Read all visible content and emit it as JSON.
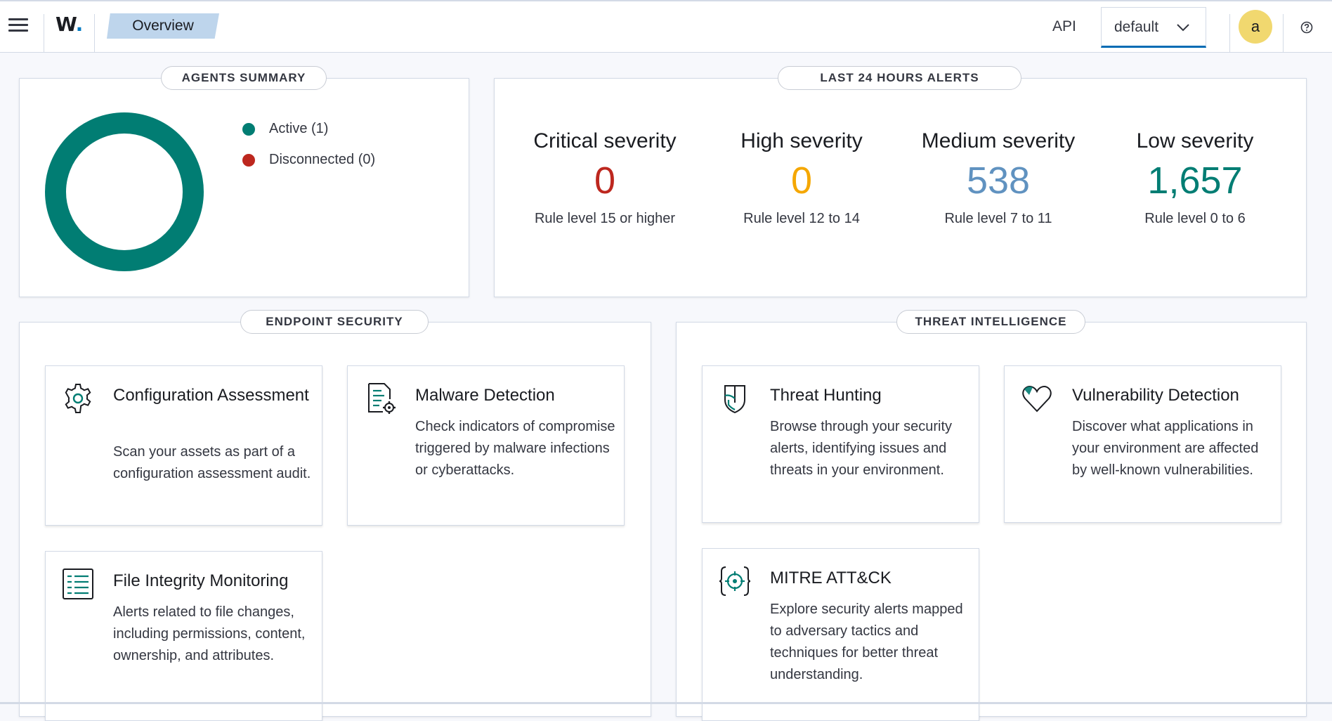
{
  "header": {
    "logo_text": "W",
    "logo_dot": ".",
    "breadcrumb": "Overview",
    "api_label": "API",
    "tenant": "default",
    "avatar_initial": "a"
  },
  "agents_summary": {
    "title": "AGENTS SUMMARY",
    "legend": [
      {
        "label": "Active (1)",
        "color": "#017d73",
        "count": 1
      },
      {
        "label": "Disconnected (0)",
        "color": "#bd271e",
        "count": 0
      }
    ]
  },
  "alerts": {
    "title": "LAST 24 HOURS ALERTS",
    "items": [
      {
        "title": "Critical severity",
        "value": "0",
        "rule": "Rule level 15 or higher",
        "color": "#bd271e"
      },
      {
        "title": "High severity",
        "value": "0",
        "rule": "Rule level 12 to 14",
        "color": "#f5a700"
      },
      {
        "title": "Medium severity",
        "value": "538",
        "rule": "Rule level 7 to 11",
        "color": "#6092c0"
      },
      {
        "title": "Low severity",
        "value": "1,657",
        "rule": "Rule level 0 to 6",
        "color": "#017d73"
      }
    ]
  },
  "endpoint_security": {
    "title": "ENDPOINT SECURITY",
    "cards": [
      {
        "icon": "gear-icon",
        "title": "Configuration Assessment",
        "desc": "Scan your assets as part of a configuration assessment audit."
      },
      {
        "icon": "document-gear-icon",
        "title": "Malware Detection",
        "desc": "Check indicators of compromise triggered by malware infections or cyberattacks."
      },
      {
        "icon": "list-table-icon",
        "title": "File Integrity Monitoring",
        "desc": "Alerts related to file changes, including permissions, content, ownership, and attributes."
      }
    ]
  },
  "threat_intelligence": {
    "title": "THREAT INTELLIGENCE",
    "cards": [
      {
        "icon": "shield-icon",
        "title": "Threat Hunting",
        "desc": "Browse through your security alerts, identifying issues and threats in your environment."
      },
      {
        "icon": "heart-icon",
        "title": "Vulnerability Detection",
        "desc": "Discover what applications in your environment are affected by well-known vulnerabilities."
      },
      {
        "icon": "crosshair-braces-icon",
        "title": "MITRE ATT&CK",
        "desc": "Explore security alerts mapped to adversary tactics and techniques for better threat understanding."
      }
    ]
  },
  "colors": {
    "accent": "#006bb4",
    "teal": "#017d73",
    "breadcrumb_bg": "#bed5ec",
    "avatar_bg": "#f1d86f"
  }
}
